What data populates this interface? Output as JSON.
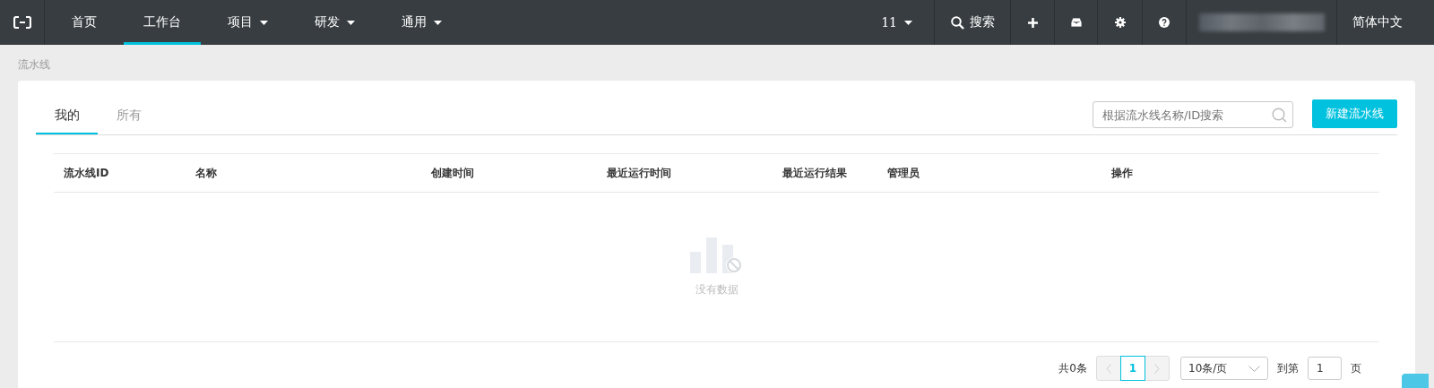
{
  "navbar": {
    "items": [
      {
        "label": "首页",
        "selected": false,
        "dropdown": false
      },
      {
        "label": "工作台",
        "selected": true,
        "dropdown": false
      },
      {
        "label": "项目",
        "selected": false,
        "dropdown": true
      },
      {
        "label": "研发",
        "selected": false,
        "dropdown": true
      },
      {
        "label": "通用",
        "selected": false,
        "dropdown": true
      }
    ],
    "counter": "11",
    "search": "搜索",
    "language": "简体中文"
  },
  "breadcrumb": "流水线",
  "tabs": [
    {
      "label": "我的",
      "selected": true
    },
    {
      "label": "所有",
      "selected": false
    }
  ],
  "search": {
    "placeholder": "根据流水线名称/ID搜索"
  },
  "create_button": "新建流水线",
  "table": {
    "columns": [
      "流水线ID",
      "名称",
      "创建时间",
      "最近运行时间",
      "最近运行结果",
      "管理员",
      "操作"
    ],
    "empty": "没有数据"
  },
  "pagination": {
    "total": "共0条",
    "page": "1",
    "page_size": "10条/页",
    "goto_label": "到第",
    "goto_value": "1",
    "goto_suffix": "页"
  }
}
